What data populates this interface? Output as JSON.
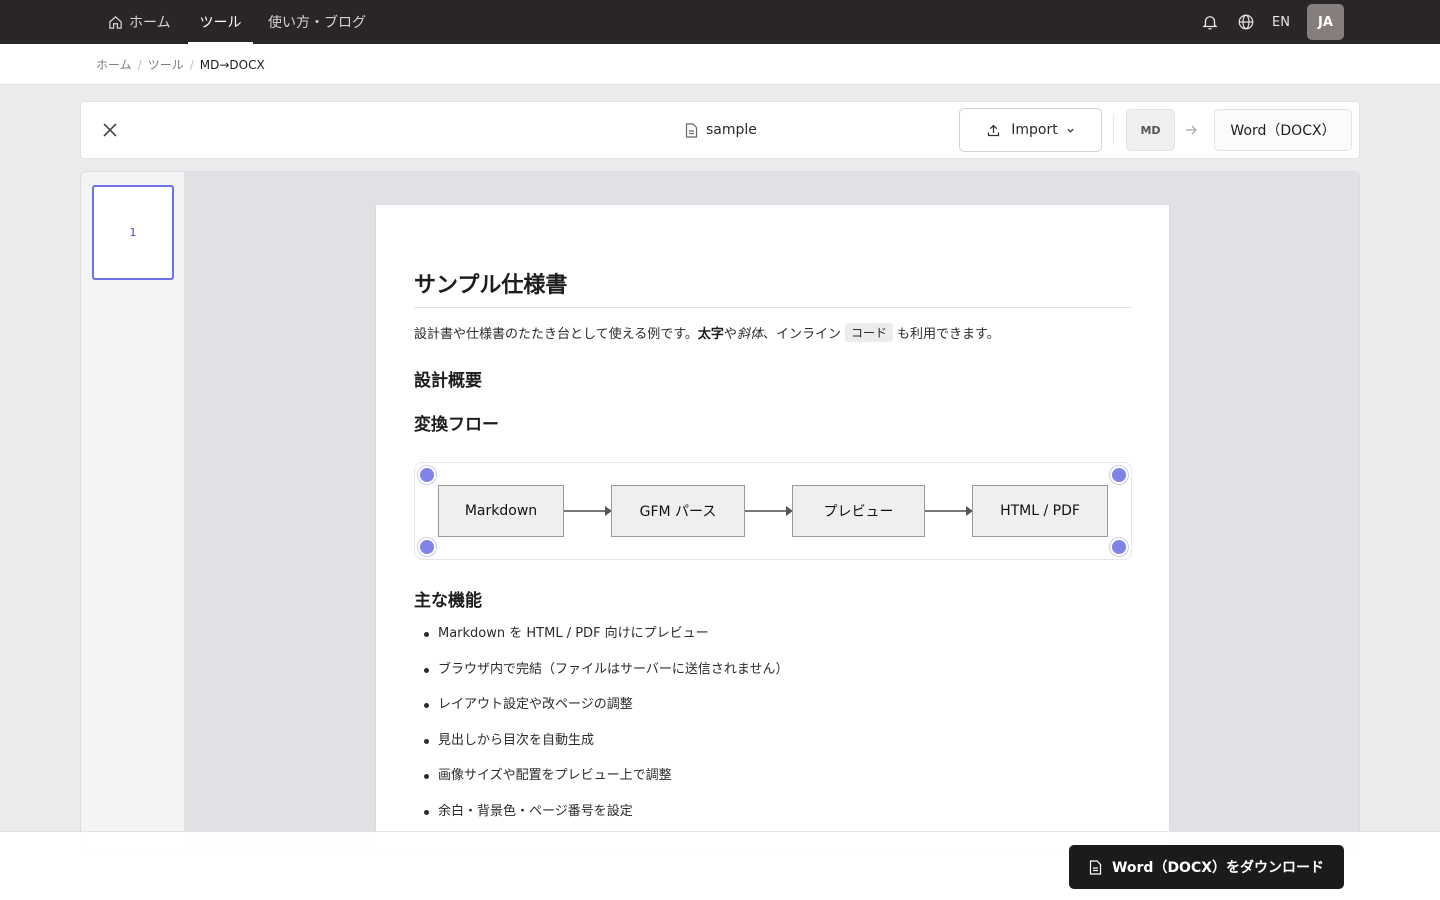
{
  "nav": {
    "home": "ホーム",
    "tools": "ツール",
    "blog": "使い方・ブログ",
    "lang": "EN",
    "avatar": "JA"
  },
  "breadcrumb": {
    "home": "ホーム",
    "tools": "ツール",
    "current": "MD→DOCX",
    "separator": "/"
  },
  "toolbar": {
    "filename": "sample",
    "import_label": "Import",
    "source_format": "MD",
    "target_format": "Word（DOCX）"
  },
  "thumbnails": [
    {
      "page": "1"
    }
  ],
  "document": {
    "title": "サンプル仕様書",
    "intro": {
      "part1": "設計書や仕様書のたたき台として使える例です。",
      "bold": "太字",
      "part2": "や ",
      "italic": "斜体",
      "part3": "、インライン ",
      "code": "コード",
      "part4": "も利用できます。"
    },
    "h_overview": "設計概要",
    "h_flow": "変換フロー",
    "flow_steps": [
      "Markdown",
      "GFM パース",
      "プレビュー",
      "HTML / PDF"
    ],
    "h_features": "主な機能",
    "features": [
      "Markdown を HTML / PDF 向けにプレビュー",
      "ブラウザ内で完結（ファイルはサーバーに送信されません）",
      "レイアウト設定や改ページの調整",
      "見出しから目次を自動生成",
      "画像サイズや配置をプレビュー上で調整",
      "余白・背景色・ページ番号を設定"
    ]
  },
  "bottombar": {
    "download_label": "Word（DOCX）をダウンロード"
  },
  "colors": {
    "nav_bg": "#2a2526",
    "accent": "#6e72e8",
    "handle": "#8184e6",
    "primary_button": "#1c1a1b"
  }
}
